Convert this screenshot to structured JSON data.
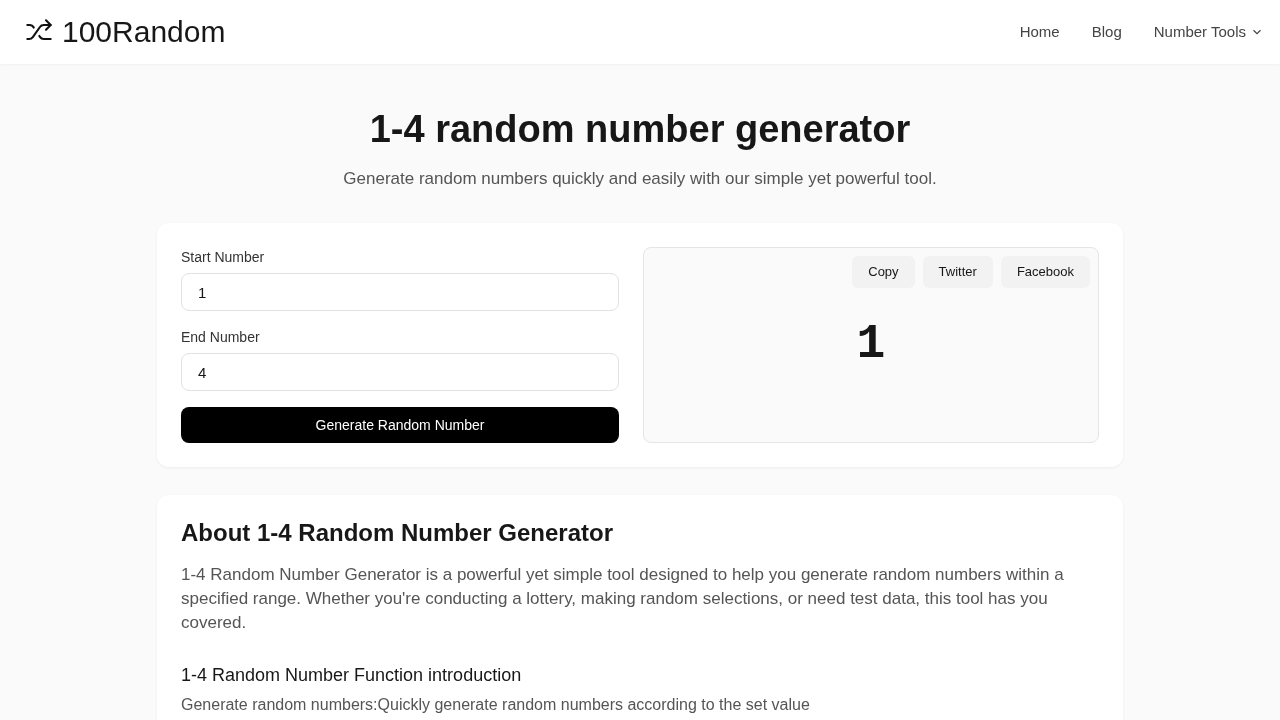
{
  "header": {
    "logo": "100Random",
    "nav": [
      {
        "label": "Home",
        "kind": "link"
      },
      {
        "label": "Blog",
        "kind": "link"
      },
      {
        "label": "Number Tools",
        "kind": "dropdown"
      }
    ]
  },
  "hero": {
    "title": "1-4 random number generator",
    "subtitle": "Generate random numbers quickly and easily with our simple yet powerful tool."
  },
  "form": {
    "fields": [
      {
        "label": "Start Number",
        "value": "1"
      },
      {
        "label": "End Number",
        "value": "4"
      }
    ],
    "button": "Generate Random Number"
  },
  "result": {
    "actions": [
      "Copy",
      "Twitter",
      "Facebook"
    ],
    "value": "1"
  },
  "about": {
    "title": "About 1-4 Random Number Generator",
    "paragraph": "1-4 Random Number Generator is a powerful yet simple tool designed to help you generate random numbers within a specified range. Whether you're conducting a lottery, making random selections, or need test data, this tool has you covered.",
    "subtitle": "1-4 Random Number Function introduction",
    "line": "Generate random numbers:Quickly generate random numbers according to the set value"
  }
}
